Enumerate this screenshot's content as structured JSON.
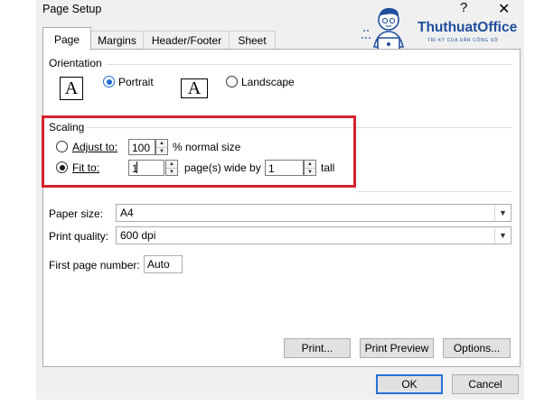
{
  "window": {
    "title": "Page Setup",
    "help_label": "?",
    "close_label": "✕"
  },
  "logo": {
    "name": "ThuthuatOffice",
    "tagline": "TRI KỲ CỦA DÂN CÔNG SỞ"
  },
  "tabs": [
    {
      "label": "Page",
      "active": true
    },
    {
      "label": "Margins",
      "active": false
    },
    {
      "label": "Header/Footer",
      "active": false
    },
    {
      "label": "Sheet",
      "active": false
    }
  ],
  "orientation": {
    "group_label": "Orientation",
    "portrait_glyph": "A",
    "portrait_label": "Portrait",
    "landscape_glyph": "A",
    "landscape_label": "Landscape",
    "selected": "Portrait"
  },
  "scaling": {
    "group_label": "Scaling",
    "adjust_label": "Adjust to:",
    "adjust_value": "100",
    "adjust_suffix": "% normal size",
    "fit_label": "Fit to:",
    "fit_wide_value": "1",
    "fit_wide_suffix": "page(s) wide by",
    "fit_tall_value": "1",
    "fit_tall_suffix": "tall",
    "selected": "Fit to"
  },
  "paper_size": {
    "label": "Paper size:",
    "value": "A4"
  },
  "print_quality": {
    "label": "Print quality:",
    "value": "600 dpi"
  },
  "first_page_number": {
    "label": "First page number:",
    "value": "Auto"
  },
  "buttons": {
    "print": "Print...",
    "print_preview": "Print Preview",
    "options": "Options...",
    "ok": "OK",
    "cancel": "Cancel"
  },
  "colors": {
    "highlight_border": "#d6222d",
    "accent": "#2a6fd4",
    "logo_brand": "#1f4e9c"
  }
}
